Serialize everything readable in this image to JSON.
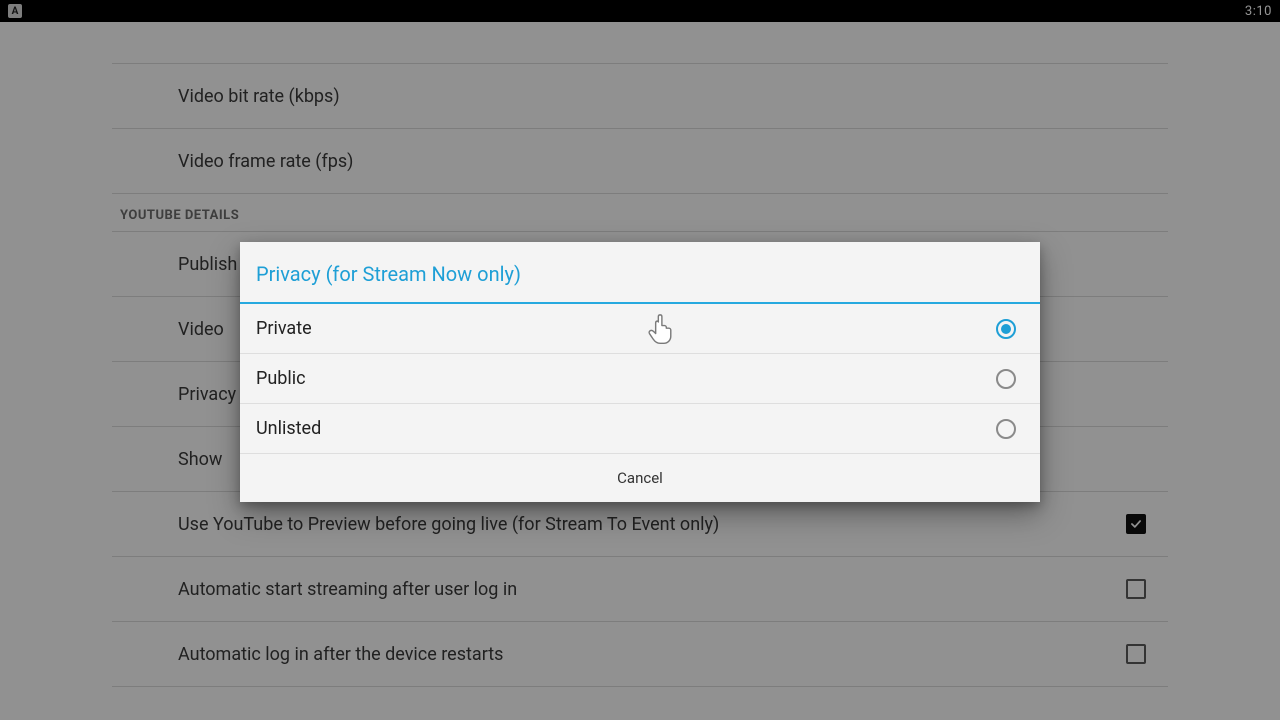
{
  "status_bar": {
    "clock": "3:10",
    "app_badge_letter": "A"
  },
  "settings": {
    "rows": {
      "video_bit_rate": "Video bit rate (kbps)",
      "video_frame_rate": "Video frame rate (fps)",
      "publish": "Publish",
      "video_truncated": "Video",
      "privacy_truncated": "Privacy",
      "show_truncated": "Show",
      "use_preview": "Use YouTube to Preview before going live (for Stream To Event only)",
      "auto_start": "Automatic start streaming after user log in",
      "auto_login": "Automatic log in after the device restarts"
    },
    "section_header": "YOUTUBE DETAILS",
    "checkbox_states": {
      "use_preview": true,
      "auto_start": false,
      "auto_login": false
    }
  },
  "dialog": {
    "title": "Privacy (for Stream Now only)",
    "options": [
      {
        "label": "Private",
        "selected": true
      },
      {
        "label": "Public",
        "selected": false
      },
      {
        "label": "Unlisted",
        "selected": false
      }
    ],
    "cancel_label": "Cancel"
  }
}
